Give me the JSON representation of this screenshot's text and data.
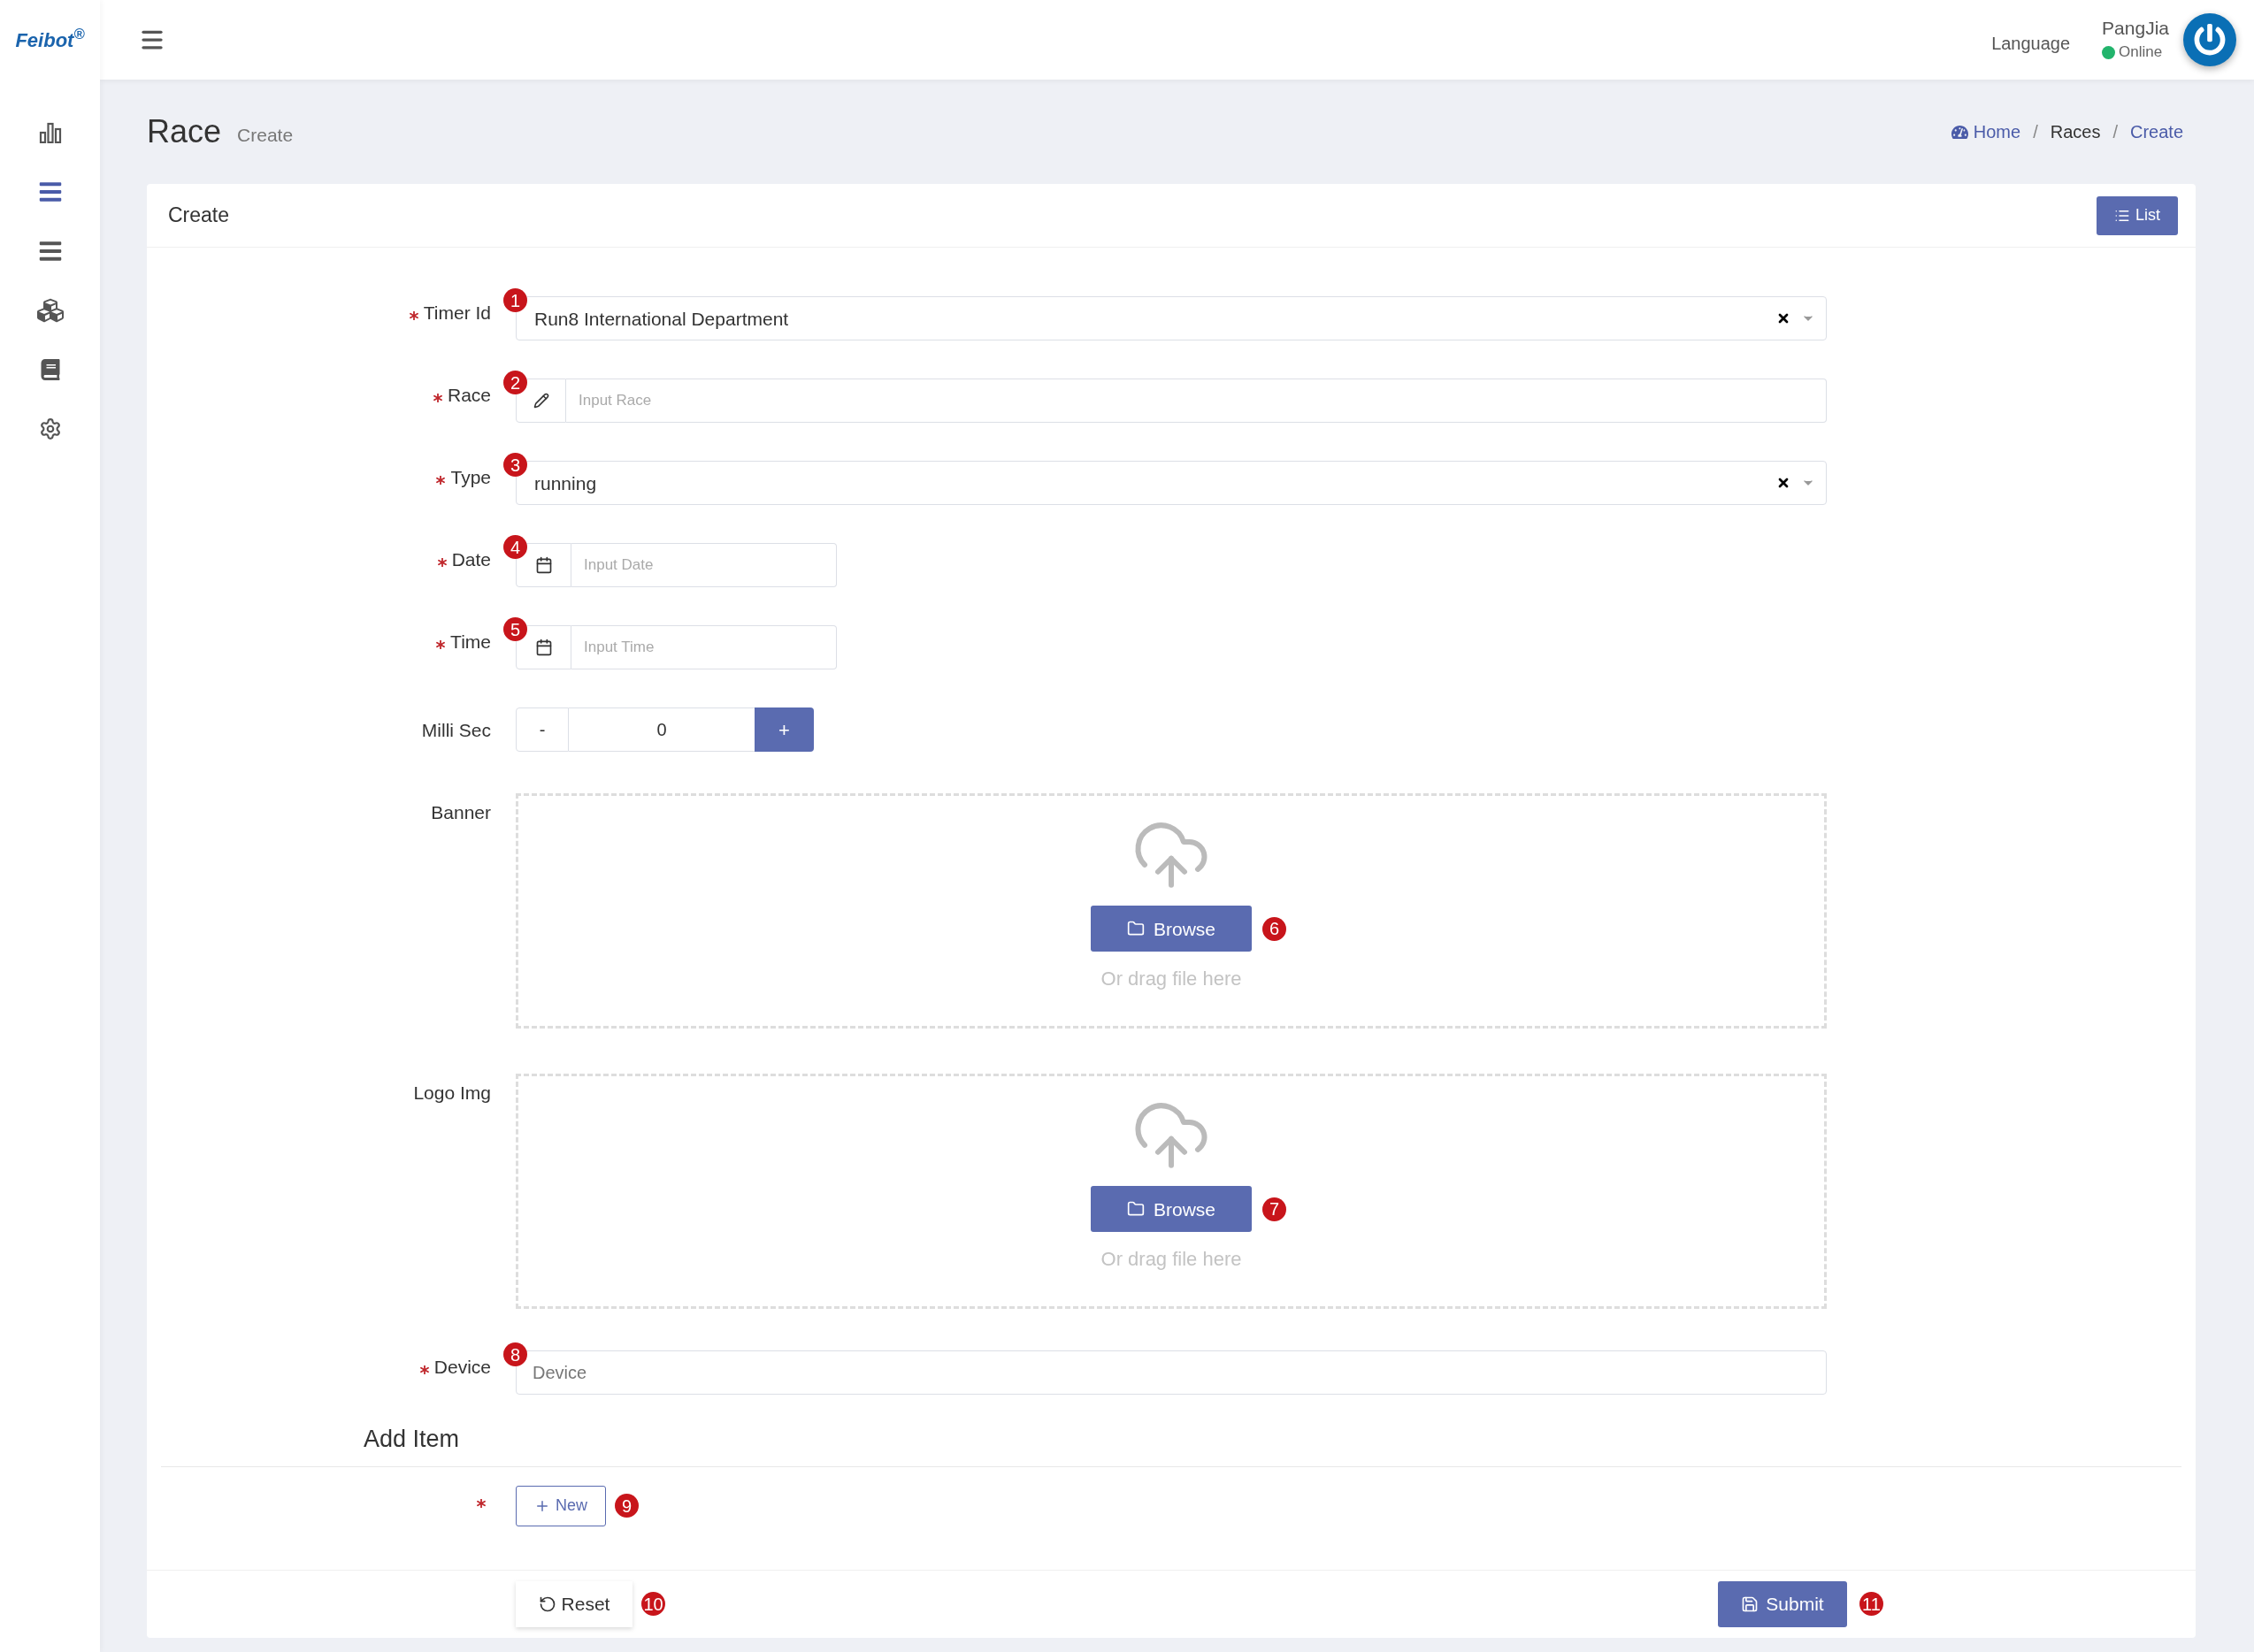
{
  "sidebar": {
    "logo": "Feibot$^{®}$",
    "items": [
      {
        "selected": false
      },
      {
        "selected": true
      },
      {
        "selected": false
      },
      {
        "selected": false
      },
      {
        "selected": false
      },
      {
        "selected": false
      }
    ]
  },
  "header": {
    "language": "Language",
    "user": {
      "name": "PangJia",
      "status": "Online"
    }
  },
  "page": {
    "title": "Race",
    "subtitle": "Create",
    "separator": "/",
    "breadcrumb": [
      {
        "label": "Home",
        "kind": "home"
      },
      {
        "label": "Races",
        "kind": "plain"
      },
      {
        "label": "Create",
        "kind": "link"
      }
    ]
  },
  "card": {
    "title": "Create",
    "list_button": "List",
    "fields": [
      {
        "kind": "select",
        "label": "Timer Id",
        "required": true,
        "marker": "1",
        "value": "Run8 International Department"
      },
      {
        "kind": "icon-text",
        "label": "Race",
        "required": true,
        "marker": "2",
        "placeholder": "Input Race"
      },
      {
        "kind": "select",
        "label": "Type",
        "required": true,
        "marker": "3",
        "value": "running"
      },
      {
        "kind": "date",
        "label": "Date",
        "required": true,
        "marker": "4",
        "placeholder": "Input Date"
      },
      {
        "kind": "date",
        "label": "Time",
        "required": true,
        "marker": "5",
        "placeholder": "Input Time"
      },
      {
        "kind": "number",
        "label": "Milli Sec",
        "required": false,
        "value": "0",
        "decrement": "-",
        "increment": "+"
      },
      {
        "kind": "upload",
        "label": "Banner",
        "required": false,
        "button": "Browse",
        "marker": "6",
        "hint": "Or drag file here"
      },
      {
        "kind": "upload",
        "label": "Logo Img",
        "required": false,
        "button": "Browse",
        "marker": "7",
        "hint": "Or drag file here"
      },
      {
        "kind": "text",
        "label": "Device",
        "required": true,
        "marker": "8",
        "placeholder": "Device"
      }
    ],
    "add_item": {
      "heading": "Add Item",
      "required": true,
      "new_button": "New",
      "marker": "9"
    },
    "footer": {
      "reset": "Reset",
      "reset_marker": "10",
      "submit": "Submit",
      "submit_marker": "11"
    }
  }
}
